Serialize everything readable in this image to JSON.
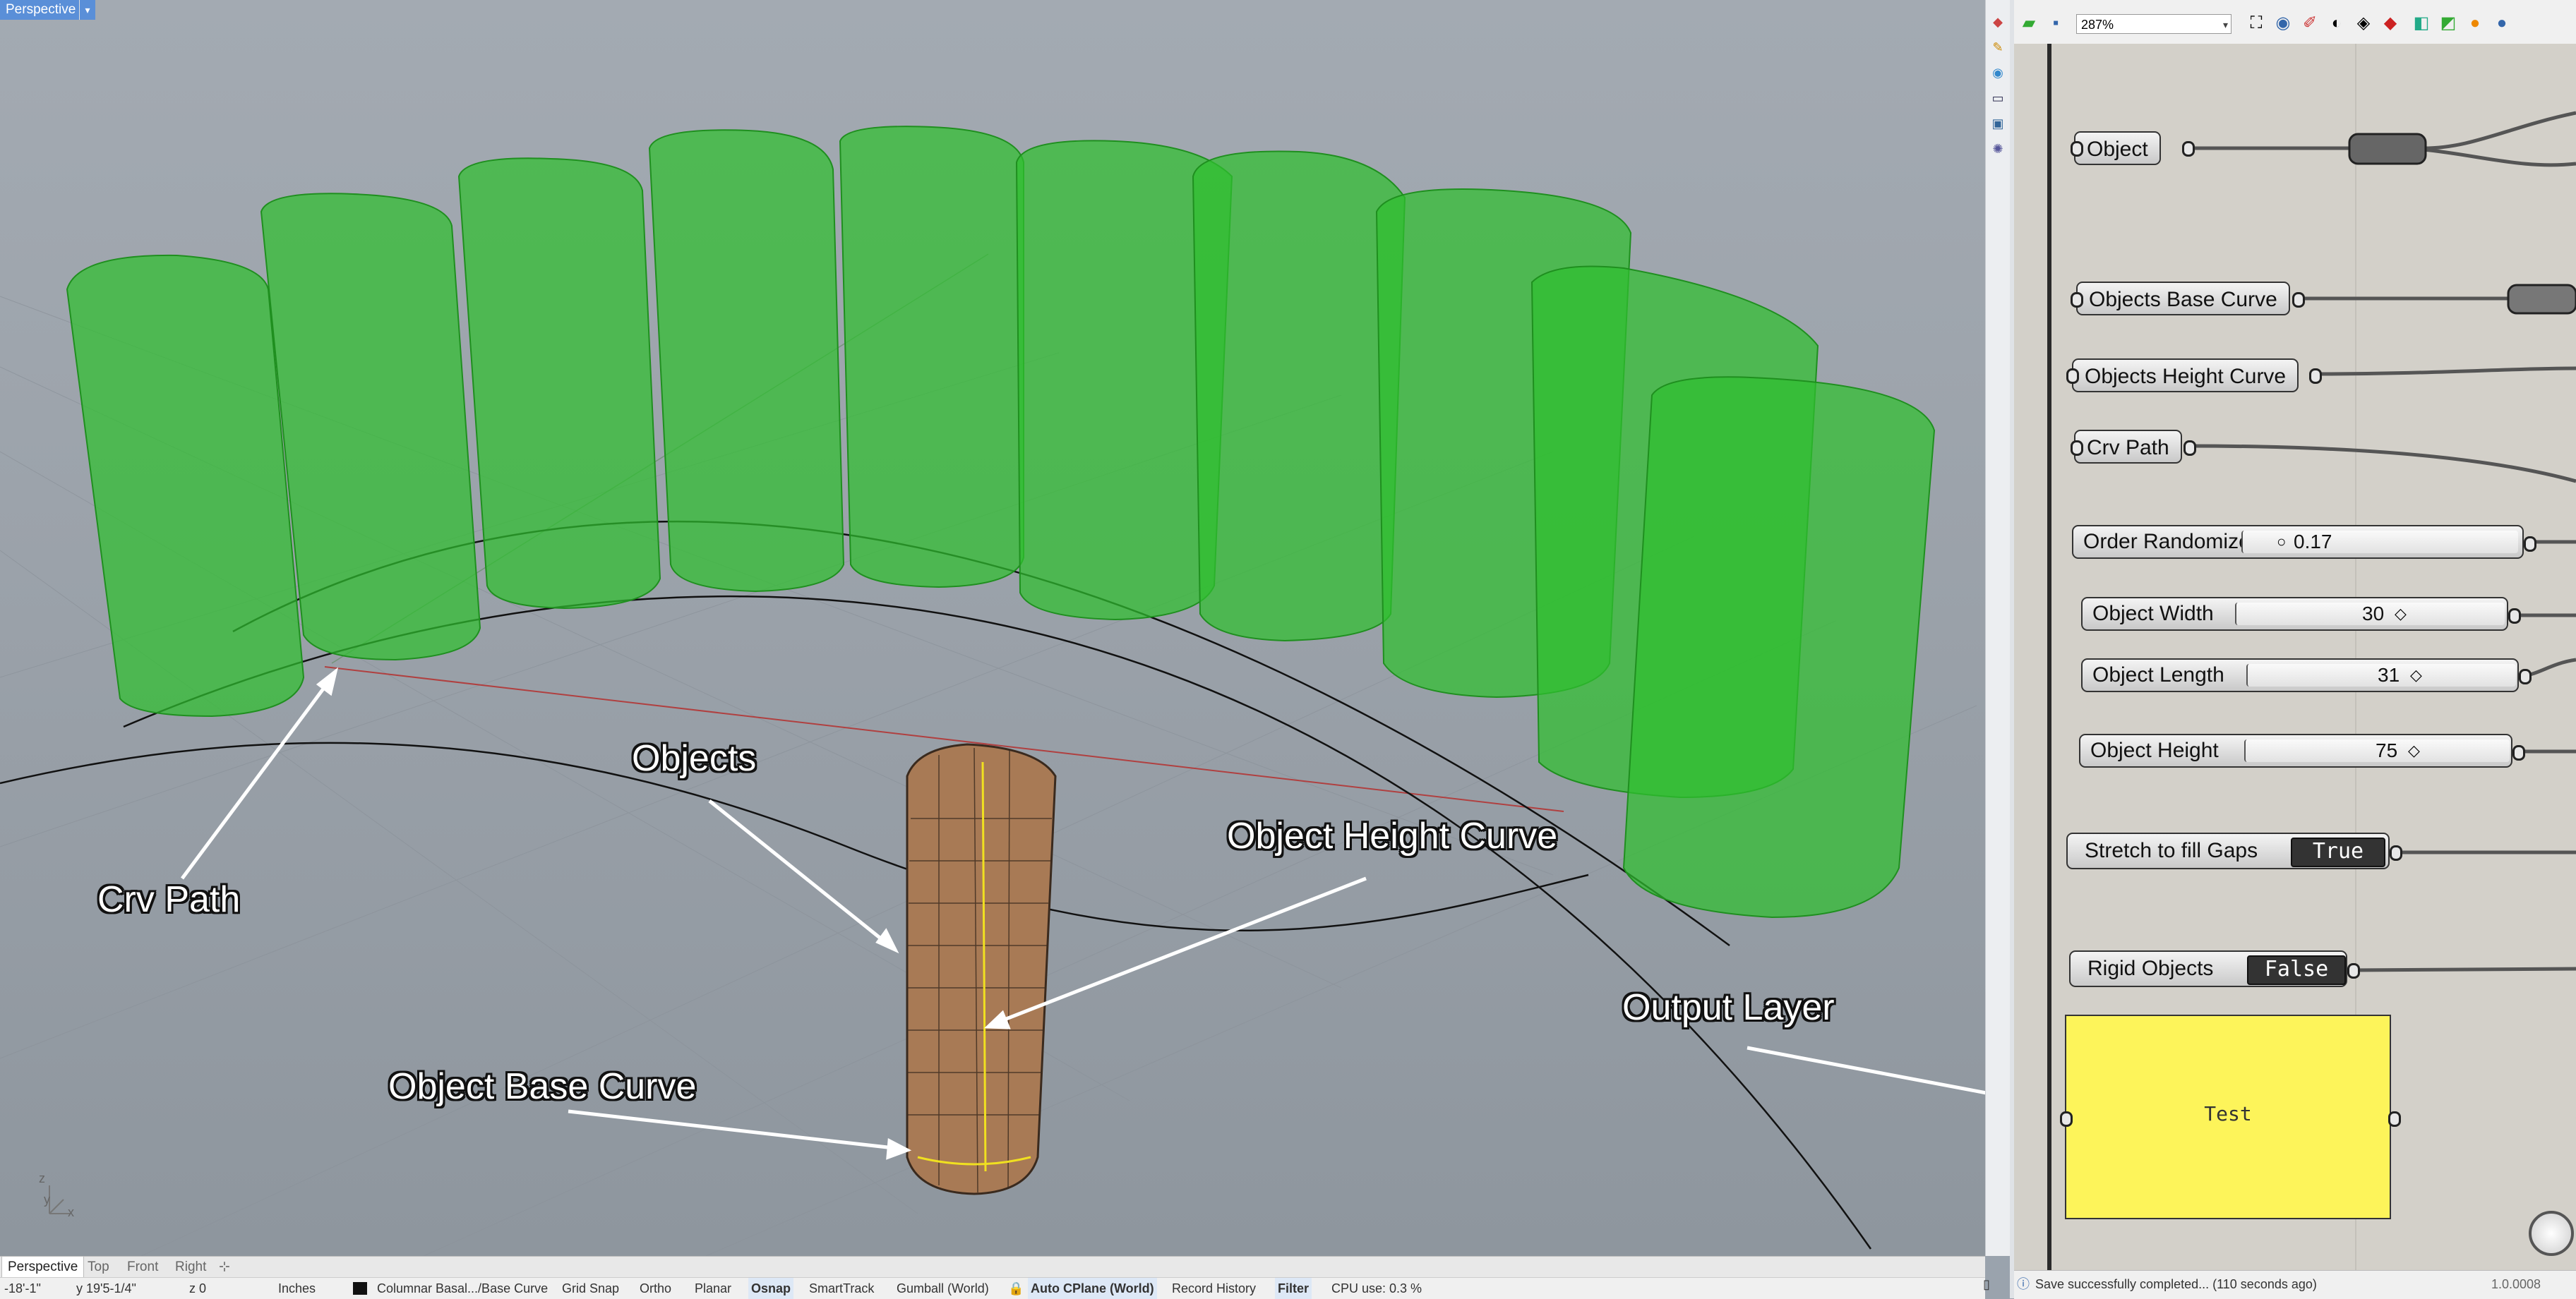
{
  "viewport": {
    "name": "Perspective",
    "annotations": {
      "crv_path": "Crv Path",
      "objects": "Objects",
      "object_height_curve": "Object Height Curve",
      "object_base_curve": "Object Base Curve",
      "output_layer": "Output Layer"
    },
    "axes": {
      "z": "z",
      "y": "y",
      "x": "x"
    }
  },
  "view_tabs": [
    "Perspective",
    "Top",
    "Front",
    "Right"
  ],
  "status_bar": {
    "x": "-18'-1\"",
    "y": "y 19'5-1/4\"",
    "z": "z 0",
    "units": "Inches",
    "layer": "Columnar Basal.../Base Curve",
    "grid_snap": "Grid Snap",
    "ortho": "Ortho",
    "planar": "Planar",
    "osnap": "Osnap",
    "smarttrack": "SmartTrack",
    "gumball": "Gumball (World)",
    "cplane": "Auto CPlane (World)",
    "record_history": "Record History",
    "filter": "Filter",
    "cpu": "CPU use: 0.3 %"
  },
  "grasshopper": {
    "zoom": "287%",
    "nodes": {
      "object": "Object",
      "objects_base_curve": "Objects Base Curve",
      "objects_height_curve": "Objects Height Curve",
      "crv_path": "Crv Path"
    },
    "sliders": {
      "order_randomizer": {
        "label": "Order Randomizer",
        "value": "0.17"
      },
      "object_width": {
        "label": "Object Width",
        "value": "30"
      },
      "object_length": {
        "label": "Object Length",
        "value": "31"
      },
      "object_height": {
        "label": "Object Height",
        "value": "75"
      }
    },
    "toggles": {
      "stretch": {
        "label": "Stretch to fill Gaps",
        "value": "True"
      },
      "rigid": {
        "label": "Rigid Objects",
        "value": "False"
      }
    },
    "panel": {
      "text": "Test"
    },
    "status": "Save successfully completed... (110 seconds ago)",
    "version": "1.0.0008"
  },
  "colors": {
    "column_green": "#2fbf2f",
    "panel_yellow": "#fdf45a",
    "viewport_label": "#5a8fd8"
  }
}
